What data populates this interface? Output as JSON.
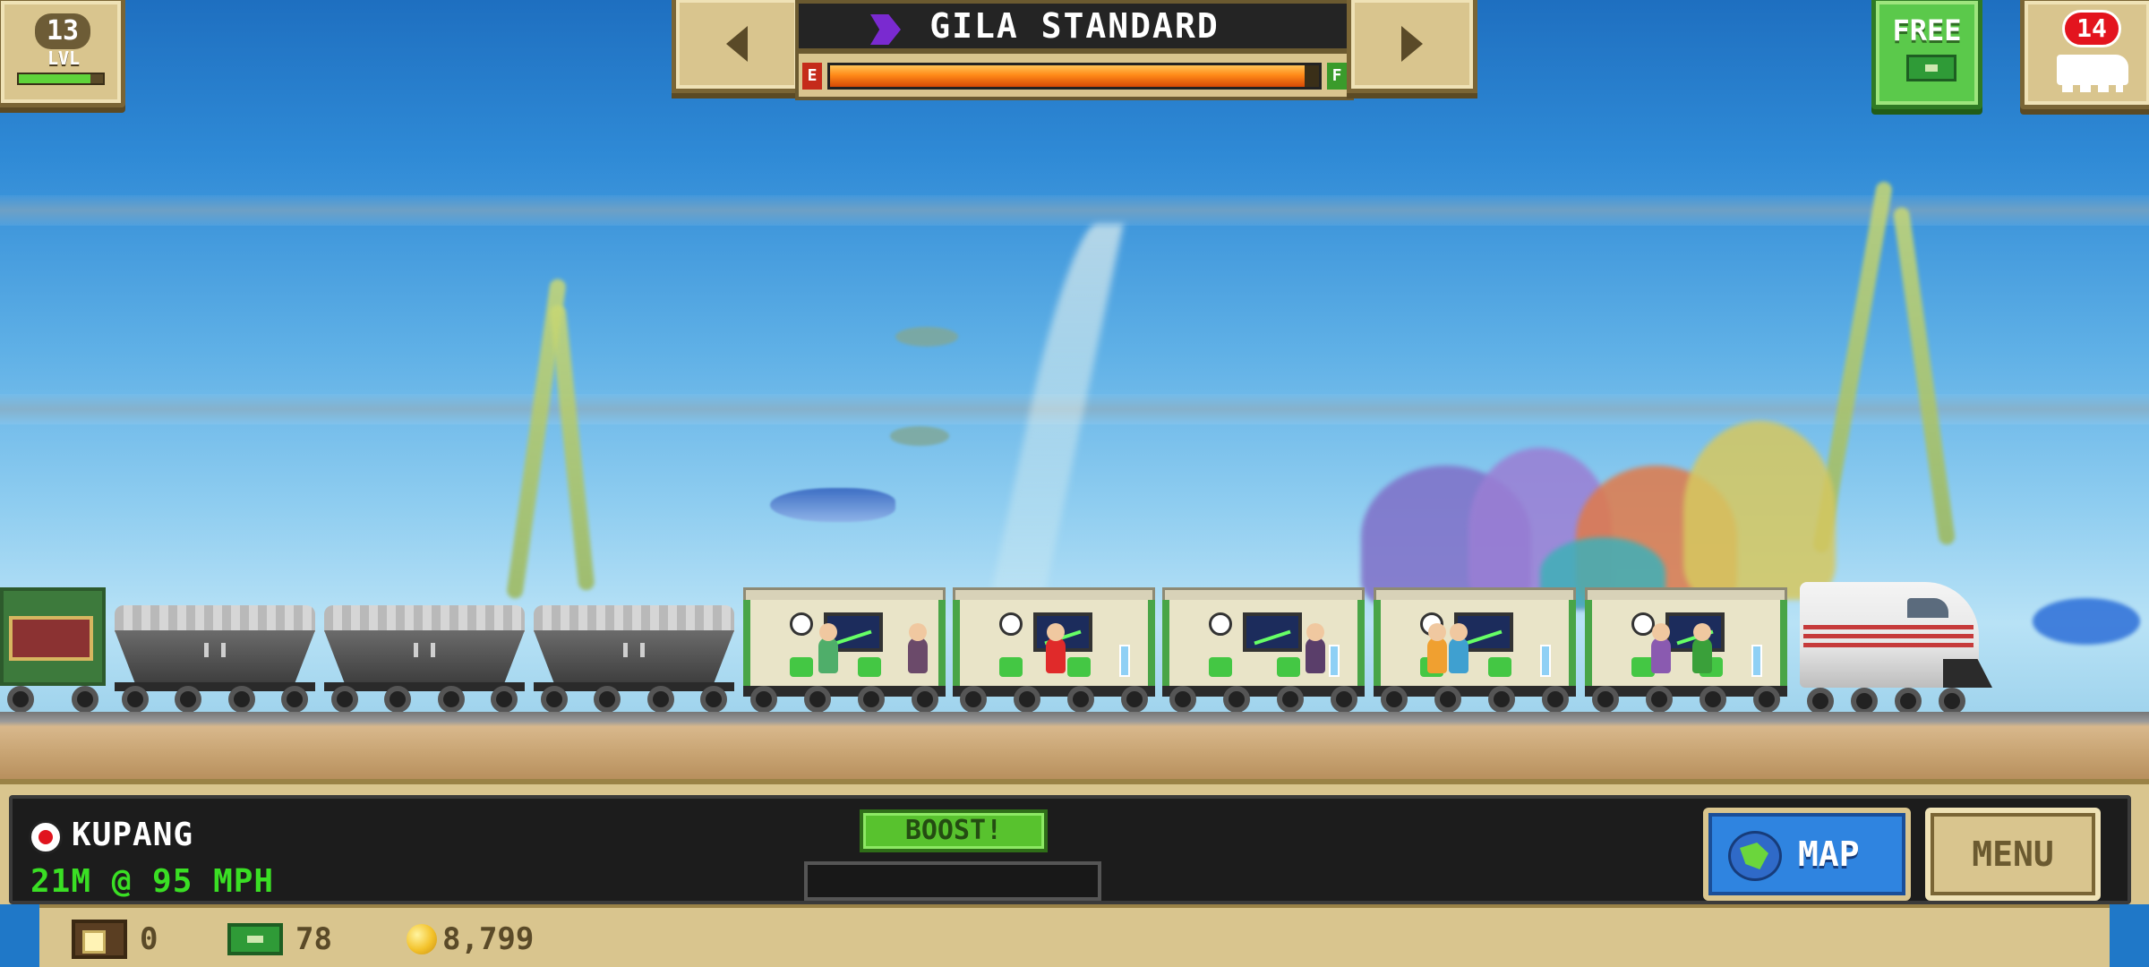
{
  "hud": {
    "level": {
      "value": "13",
      "label": "LVL",
      "xp_progress": 0.85
    },
    "train": {
      "name": "GILA STANDARD",
      "company_icon": "purple-chevron-icon",
      "fuel": {
        "empty_label": "E",
        "full_label": "F",
        "level": 0.97
      }
    },
    "free_bux": {
      "label": "FREE",
      "icon": "cash-icon"
    },
    "trains_count": {
      "value": "14",
      "icon": "train-icon"
    }
  },
  "status": {
    "station": "KUPANG",
    "distance_speed": "21M @ 95 MPH",
    "boost_label": "BOOST!",
    "boost_progress": 0.0
  },
  "buttons": {
    "map_label": "MAP",
    "menu_label": "MENU"
  },
  "resources": {
    "crates": "0",
    "bux": "78",
    "coins": "8,799"
  },
  "colors": {
    "panel_tan": "#d9c58e",
    "panel_border": "#7a6535",
    "boost_green": "#58c22e",
    "readout_green": "#3adf24",
    "map_blue": "#2f84e0",
    "fuel_orange": "#ff8a18"
  }
}
